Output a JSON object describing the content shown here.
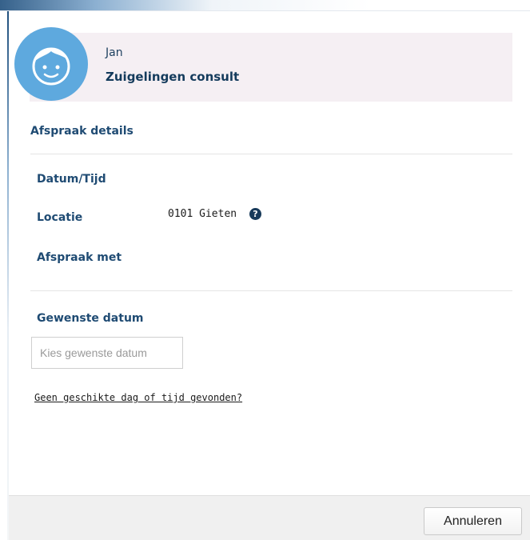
{
  "patient": {
    "name": "Jan",
    "appointment_type": "Zuigelingen consult"
  },
  "details": {
    "heading": "Afspraak details",
    "datetime_label": "Datum/Tijd",
    "location_label": "Locatie",
    "location_value": "0101 Gieten",
    "appointment_with_label": "Afspraak met"
  },
  "preferred_date": {
    "label": "Gewenste datum",
    "placeholder": "Kies gewenste datum"
  },
  "no_slot_link": "Geen geschikte dag of tijd gevonden?",
  "footer": {
    "cancel_label": "Annuleren"
  },
  "icons": {
    "avatar": "baby-face-icon",
    "help": "question-circle-icon"
  },
  "colors": {
    "accent": "#1f4b73",
    "avatar_bg": "#5ea9de",
    "card_bg": "#f5eff3"
  }
}
